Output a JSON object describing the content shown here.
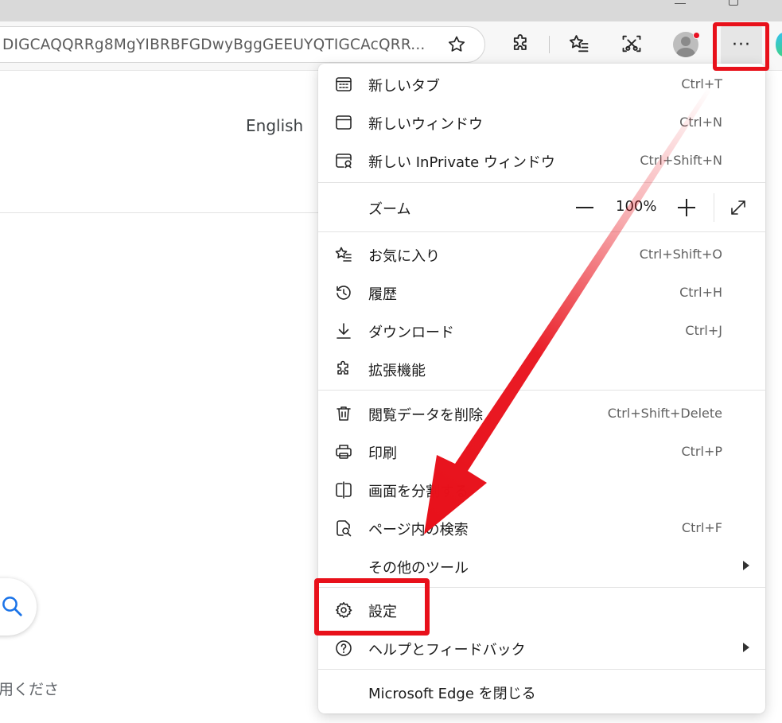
{
  "addressbar": {
    "url": "DIGCAQQRRg8MgYIBRBFGDwyBggGEEUYQTIGCAcQRR..."
  },
  "page": {
    "language_link": "English",
    "partial_text": "用くださ"
  },
  "toolbar": {
    "icons": [
      "favorite-star-icon",
      "extensions-icon",
      "favorites-icon",
      "web-capture-icon",
      "profile-avatar",
      "more-icon"
    ],
    "more_label": "···"
  },
  "menu": {
    "items": [
      {
        "label": "新しいタブ",
        "shortcut": "Ctrl+T",
        "icon": "new-tab-icon"
      },
      {
        "label": "新しいウィンドウ",
        "shortcut": "Ctrl+N",
        "icon": "new-window-icon"
      },
      {
        "label": "新しい InPrivate ウィンドウ",
        "shortcut": "Ctrl+Shift+N",
        "icon": "inprivate-icon"
      },
      {
        "label": "お気に入り",
        "shortcut": "Ctrl+Shift+O",
        "icon": "favorites-icon"
      },
      {
        "label": "履歴",
        "shortcut": "Ctrl+H",
        "icon": "history-icon"
      },
      {
        "label": "ダウンロード",
        "shortcut": "Ctrl+J",
        "icon": "download-icon"
      },
      {
        "label": "拡張機能",
        "shortcut": "",
        "icon": "extensions-icon"
      },
      {
        "label": "閲覧データを削除",
        "shortcut": "Ctrl+Shift+Delete",
        "icon": "trash-icon"
      },
      {
        "label": "印刷",
        "shortcut": "Ctrl+P",
        "icon": "print-icon"
      },
      {
        "label": "画面を分割する",
        "shortcut": "",
        "icon": "split-screen-icon"
      },
      {
        "label": "ページ内の検索",
        "shortcut": "Ctrl+F",
        "icon": "find-in-page-icon"
      },
      {
        "label": "その他のツール",
        "shortcut": "",
        "icon": ""
      },
      {
        "label": "設定",
        "shortcut": "",
        "icon": "gear-icon"
      },
      {
        "label": "ヘルプとフィードバック",
        "shortcut": "",
        "icon": "help-icon"
      },
      {
        "label": "Microsoft Edge を閉じる",
        "shortcut": "",
        "icon": ""
      }
    ],
    "zoom": {
      "label": "ズーム",
      "value": "100%"
    }
  },
  "colors": {
    "highlight": "#e8101a",
    "accent_blue": "#1a73e8"
  }
}
